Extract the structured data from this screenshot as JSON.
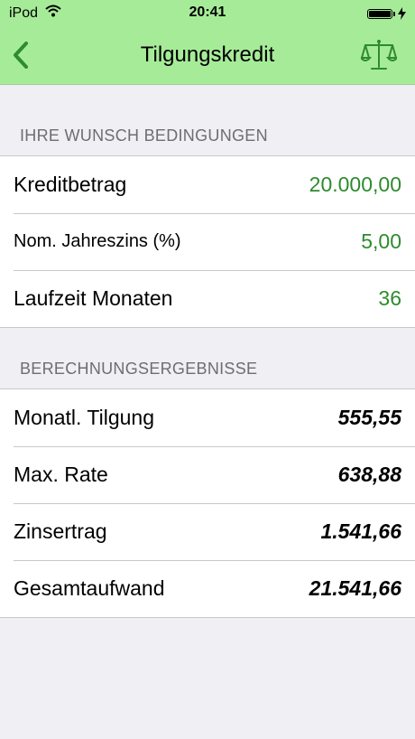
{
  "status_bar": {
    "device": "iPod",
    "time": "20:41"
  },
  "nav": {
    "title": "Tilgungskredit",
    "back_icon": "chevron-left-icon",
    "right_icon": "scale-icon",
    "accent": "#2e8b2e"
  },
  "section1": {
    "header": "IHRE WUNSCH BEDINGUNGEN",
    "rows": [
      {
        "label": "Kreditbetrag",
        "value": "20.000,00"
      },
      {
        "label": "Nom. Jahreszins (%)",
        "value": "5,00"
      },
      {
        "label": "Laufzeit Monaten",
        "value": "36"
      }
    ]
  },
  "section2": {
    "header": "BERECHNUNGSERGEBNISSE",
    "rows": [
      {
        "label": "Monatl. Tilgung",
        "value": "555,55"
      },
      {
        "label": "Max. Rate",
        "value": "638,88"
      },
      {
        "label": "Zinsertrag",
        "value": "1.541,66"
      },
      {
        "label": "Gesamtaufwand",
        "value": "21.541,66"
      }
    ]
  }
}
